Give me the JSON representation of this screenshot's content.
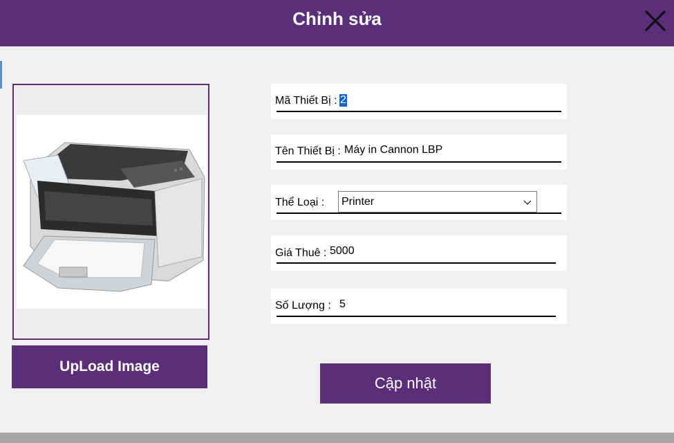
{
  "dialog": {
    "title": "Chỉnh sửa",
    "accent_color": "#5b2e7a"
  },
  "image_panel": {
    "upload_label": "UpLoad Image",
    "image_subject": "printer-image"
  },
  "form": {
    "ma_thiet_bi": {
      "label": "Mã Thiết Bị :",
      "value": "2"
    },
    "ten_thiet_bi": {
      "label": "Tên Thiết Bị :",
      "value": "Máy in Cannon LBP"
    },
    "the_loai": {
      "label": "Thể  Loại :",
      "value": "Printer"
    },
    "gia_thue": {
      "label": "Giá Thuê :",
      "value": "5000"
    },
    "so_luong": {
      "label": "Số Lượng :",
      "value": "5"
    }
  },
  "actions": {
    "update_label": "Cập nhật"
  }
}
